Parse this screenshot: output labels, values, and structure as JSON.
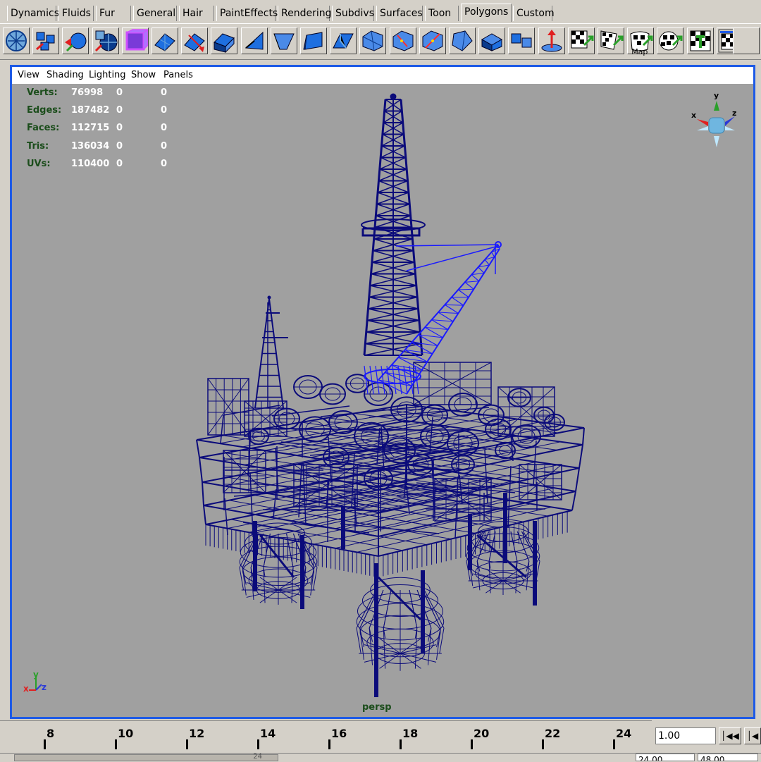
{
  "shelf": {
    "tabs": [
      "Dynamics",
      "Fluids",
      "Fur",
      "General",
      "Hair",
      "PaintEffects",
      "Rendering",
      "Subdivs",
      "Surfaces",
      "Toon",
      "Polygons",
      "Custom"
    ],
    "active": "Polygons"
  },
  "toolbar": {
    "icons": [
      "sphere-icon",
      "create-cubes-icon",
      "poly-sphere-red-icon",
      "poly-ball-icon",
      "poly-cube-selected-icon",
      "plane-icon",
      "split-polygon-icon",
      "extrude-face-icon",
      "extrude-edge-icon",
      "bevel-icon",
      "smooth-icon",
      "wedge-icon",
      "merge-icon",
      "split-edge-icon",
      "poke-icon",
      "chamfer-icon",
      "combine-icon",
      "separate-icon",
      "sculpt-icon",
      "planar-map-icon",
      "cylindrical-map-icon",
      "spherical-map-icon",
      "automatic-map-icon",
      "uv-editor-icon",
      "texture-view-icon"
    ],
    "map_text": "Map"
  },
  "panel_menu": [
    "View",
    "Shading",
    "Lighting",
    "Show",
    "Panels"
  ],
  "hud": {
    "rows": [
      {
        "label": "Verts:",
        "v1": "76998",
        "v2": "0",
        "v3": "0"
      },
      {
        "label": "Edges:",
        "v1": "187482",
        "v2": "0",
        "v3": "0"
      },
      {
        "label": "Faces:",
        "v1": "112715",
        "v2": "0",
        "v3": "0"
      },
      {
        "label": "Tris:",
        "v1": "136034",
        "v2": "0",
        "v3": "0"
      },
      {
        "label": "UVs:",
        "v1": "110400",
        "v2": "0",
        "v3": "0"
      }
    ]
  },
  "view_cube": {
    "x": "x",
    "y": "y",
    "z": "z"
  },
  "axis_small": {
    "x": "x",
    "y": "y",
    "z": "z"
  },
  "camera_label": "persp",
  "timeline": {
    "ticks": [
      "8",
      "10",
      "12",
      "14",
      "16",
      "18",
      "20",
      "22",
      "24"
    ],
    "current_frame": "1.00",
    "range_start": "24.00",
    "range_end": "48.00",
    "slider_label": "24"
  },
  "colors": {
    "wire_dark": "#0b0b7a",
    "wire_selected": "#1a1aff",
    "viewport_bg": "#a0a0a0",
    "frame_border": "#1e5ae6"
  }
}
